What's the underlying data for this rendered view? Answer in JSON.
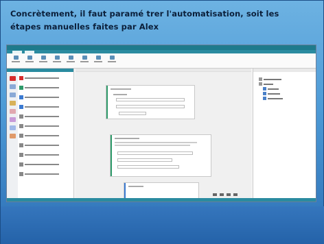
{
  "slide": {
    "title_line1": "Concrètement, il faut paramé trer  l'automatisation, soit les",
    "title_line2": "étapes manuelles faites par Alex"
  },
  "colors": {
    "slide_bg_top": "#6db2e2",
    "slide_bg_bottom": "#2c6fb5",
    "app_titlebar": "#1e7a8c",
    "accent": "#2a8ba0",
    "action_green": "#2e9a6a",
    "action_blue": "#3b7ad1"
  },
  "screenshot": {
    "description_kind": "embedded-app-screenshot",
    "left_icon_colors": [
      "#d62b2b",
      "#8aa9d6",
      "#8aa9d6",
      "#d8b25a",
      "#e0a8b0",
      "#c79ad8",
      "#9fb8e8",
      "#e09a6a"
    ]
  }
}
